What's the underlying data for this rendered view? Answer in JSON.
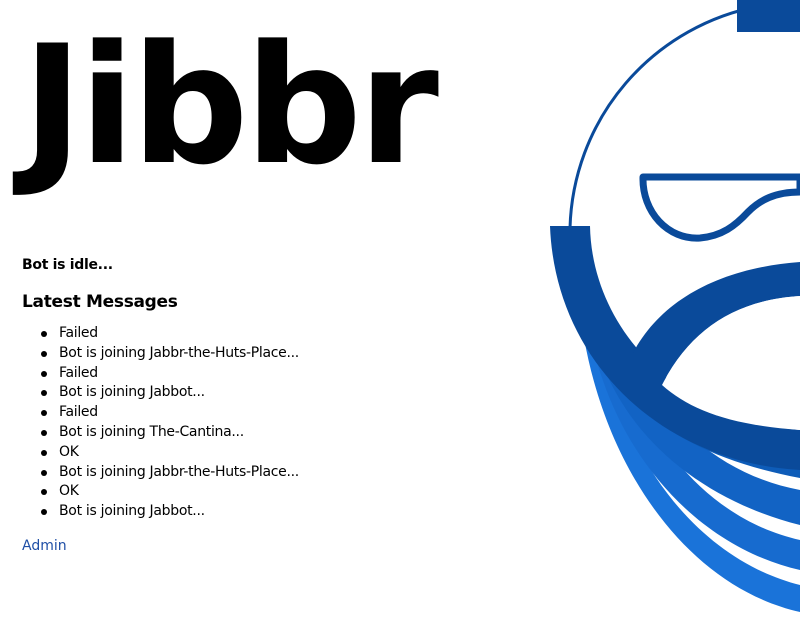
{
  "brand": {
    "title": "Jibbr",
    "logo_icon": "bearded-face-logo-icon"
  },
  "status": {
    "text": "Bot is idle..."
  },
  "messages": {
    "heading": "Latest Messages",
    "items": [
      "Failed",
      "Bot is joining Jabbr-the-Huts-Place...",
      "Failed",
      "Bot is joining Jabbot...",
      "Failed",
      "Bot is joining The-Cantina...",
      "OK",
      "Bot is joining Jabbr-the-Huts-Place...",
      "OK",
      "Bot is joining Jabbot..."
    ]
  },
  "nav": {
    "admin_label": "Admin"
  },
  "colors": {
    "dark_blue": "#0a4a9a",
    "mid_blue": "#0e5cb8",
    "bright_blue": "#1a73d9",
    "link": "#1f4fa6"
  }
}
